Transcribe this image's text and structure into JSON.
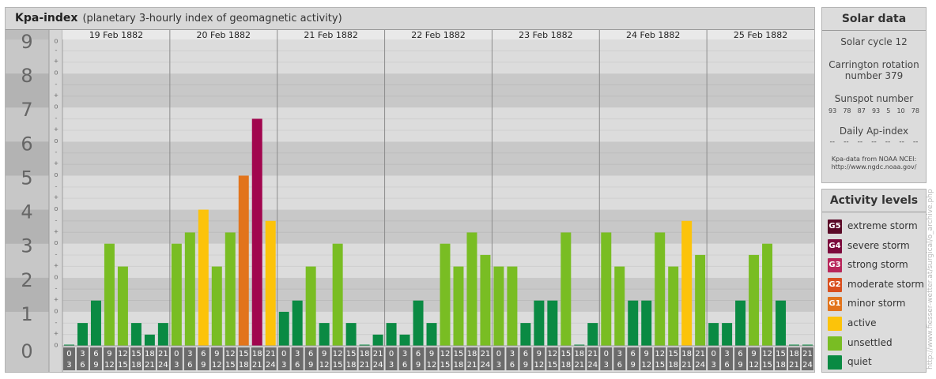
{
  "chart": {
    "title": "Kpa-index",
    "subtitle": "(planetary 3-hourly index of geomagnetic activity)"
  },
  "chart_data": {
    "type": "bar",
    "days": [
      "19 Feb 1882",
      "20 Feb 1882",
      "21 Feb 1882",
      "22 Feb 1882",
      "23 Feb 1882",
      "24 Feb 1882",
      "25 Feb 1882"
    ],
    "interval_start": [
      "0",
      "3",
      "6",
      "9",
      "12",
      "15",
      "18",
      "21"
    ],
    "interval_end": [
      "3",
      "6",
      "9",
      "12",
      "15",
      "18",
      "21",
      "24"
    ],
    "values": [
      [
        0.0,
        0.67,
        1.33,
        3.0,
        2.33,
        0.67,
        0.33,
        0.67
      ],
      [
        3.0,
        3.33,
        4.0,
        2.33,
        3.33,
        5.0,
        6.67,
        3.67
      ],
      [
        1.0,
        1.33,
        2.33,
        0.67,
        3.0,
        0.67,
        0.0,
        0.33
      ],
      [
        0.67,
        0.33,
        1.33,
        0.67,
        3.0,
        2.33,
        3.33,
        2.67
      ],
      [
        2.33,
        2.33,
        0.67,
        1.33,
        1.33,
        3.33,
        0.0,
        0.67
      ],
      [
        3.33,
        2.33,
        1.33,
        1.33,
        3.33,
        2.33,
        3.67,
        2.67
      ],
      [
        0.67,
        0.67,
        1.33,
        2.67,
        3.0,
        1.33,
        0.0,
        0.0
      ]
    ],
    "y_ticks": [
      "0",
      "1",
      "2",
      "3",
      "4",
      "5",
      "6",
      "7",
      "8",
      "9"
    ],
    "minor_ticks": [
      "o",
      "+",
      "-"
    ],
    "ylim": [
      0,
      9
    ]
  },
  "colors": {
    "quiet": "#0a8a43",
    "unsettled": "#79bd23",
    "active": "#fcc30a",
    "g1": "#e2741c",
    "g2": "#d94f1e",
    "g3": "#c02a57",
    "g4": "#a1064e",
    "g5": "#5a0a27"
  },
  "solar": {
    "title": "Solar data",
    "cycle": "Solar cycle 12",
    "carrington_line1": "Carrington rotation",
    "carrington_line2": "number 379",
    "sunspot_label": "Sunspot number",
    "sunspot_values": [
      "93",
      "78",
      "87",
      "93",
      "5",
      "10",
      "78"
    ],
    "ap_label": "Daily Ap-index",
    "ap_values": [
      "--",
      "--",
      "--",
      "--",
      "--",
      "--",
      "--"
    ],
    "source_line1": "Kpa-data from NOAA NCEI:",
    "source_line2": "http://www.ngdc.noaa.gov/"
  },
  "levels": {
    "title": "Activity levels",
    "items": [
      {
        "badge": "G5",
        "label": "extreme storm",
        "color": "#5a0a27"
      },
      {
        "badge": "G4",
        "label": "severe storm",
        "color": "#7c0a3c"
      },
      {
        "badge": "G3",
        "label": "strong storm",
        "color": "#b8265a"
      },
      {
        "badge": "G2",
        "label": "moderate storm",
        "color": "#d94f1e"
      },
      {
        "badge": "G1",
        "label": "minor storm",
        "color": "#e2741c"
      },
      {
        "badge": "",
        "label": "active",
        "color": "#fcc30a"
      },
      {
        "badge": "",
        "label": "unsettled",
        "color": "#79bd23"
      },
      {
        "badge": "",
        "label": "quiet",
        "color": "#0a8a43"
      }
    ]
  },
  "watermark": "http://www.fiesser-wetter.at/surgical/o_archive.php"
}
